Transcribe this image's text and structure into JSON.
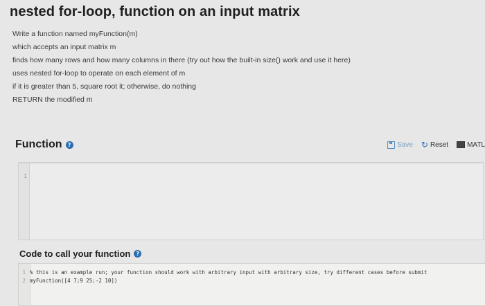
{
  "title": "nested for-loop, function on an input matrix",
  "description": [
    "Write a function named myFunction(m)",
    "which accepts an input matrix m",
    "finds how many rows and how many columns in there (try out how the built-in size() work and use it here)",
    "uses nested for-loop to operate on each element of m",
    "if it is greater than 5, square root it; otherwise, do nothing",
    "RETURN the modified m"
  ],
  "function_section": {
    "heading": "Function",
    "toolbar": {
      "save": "Save",
      "reset": "Reset",
      "matlab": "MATL"
    },
    "editor_line_number": "1"
  },
  "call_section": {
    "heading": "Code to call your function",
    "lines": [
      {
        "number": "1",
        "code": "% this is an example run; your function should work with arbitrary input with arbitrary size, try different cases before submit"
      },
      {
        "number": "2",
        "code": "myFunction([4 7;9 25;-2 10])"
      }
    ]
  }
}
